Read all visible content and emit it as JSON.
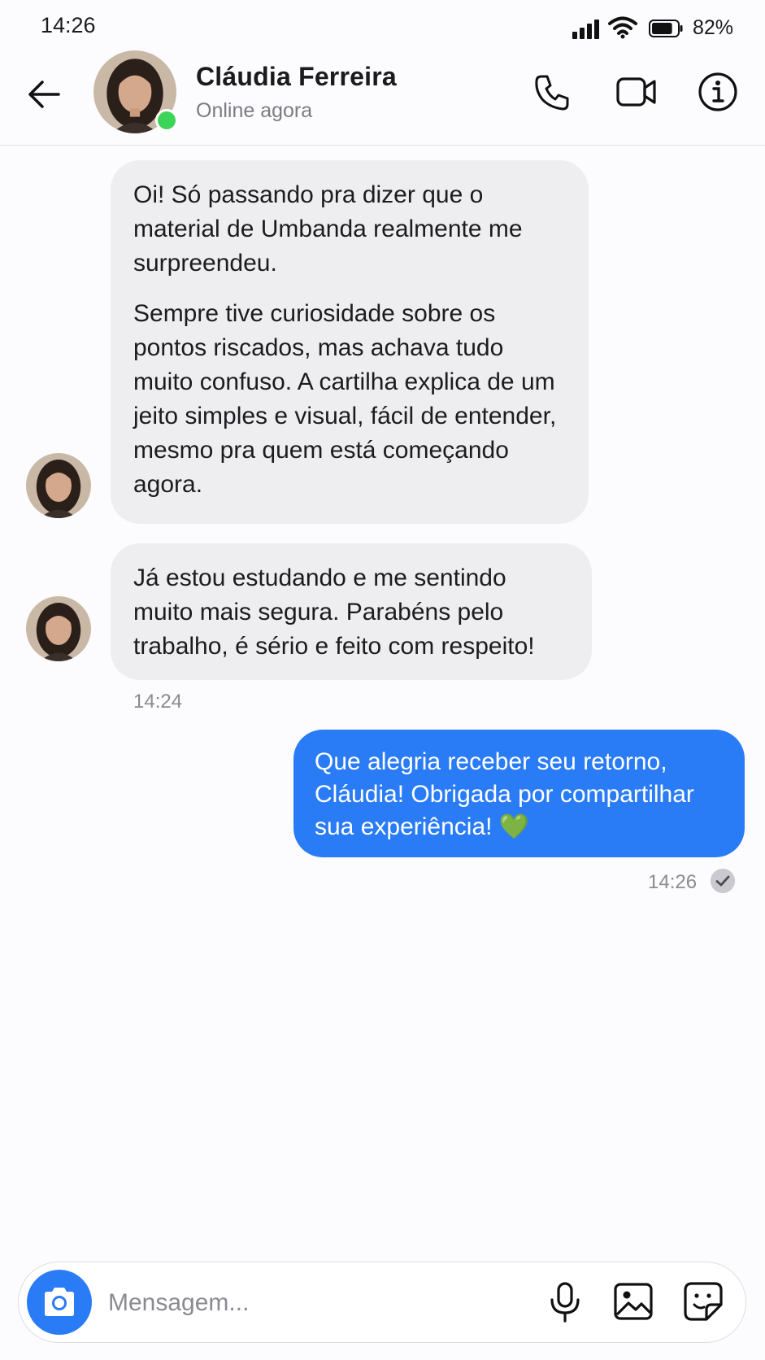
{
  "status_bar": {
    "time": "14:26",
    "battery_percent": "82%",
    "battery_level": 0.82,
    "icons": [
      "signal-icon",
      "wifi-icon",
      "battery-icon"
    ]
  },
  "header": {
    "contact_name": "Cláudia Ferreira",
    "contact_status": "Online agora",
    "online_indicator_color": "#3dd45a",
    "icons": [
      "back-arrow-icon",
      "phone-icon",
      "video-camera-icon",
      "info-icon"
    ]
  },
  "conversation": {
    "incoming": [
      {
        "paragraphs": [
          "Oi! Só passando pra dizer que o material de Umbanda realmente me surpreendeu.",
          "Sempre tive curiosidade sobre os pontos riscados, mas achava tudo muito confuso. A cartilha explica de um jeito simples e visual, fácil de entender, mesmo pra quem está começando agora."
        ]
      },
      {
        "paragraphs": [
          "Já estou estudando e me sentindo muito mais segura. Parabéns pelo trabalho, é sério e feito com respeito!"
        ],
        "time": "14:24"
      }
    ],
    "outgoing": [
      {
        "text": "Que alegria receber seu retorno, Cláudia! Obrigada por compartilhar sua experiência! 💚",
        "time": "14:26",
        "status_icon": "read-check-icon"
      }
    ]
  },
  "composer": {
    "placeholder": "Mensagem...",
    "value": "",
    "icons": [
      "camera-icon",
      "microphone-icon",
      "gallery-icon",
      "sticker-icon"
    ]
  },
  "colors": {
    "accent": "#2a7cf6",
    "incoming_bubble": "#eeeef1",
    "background": "#fcfcfe"
  }
}
